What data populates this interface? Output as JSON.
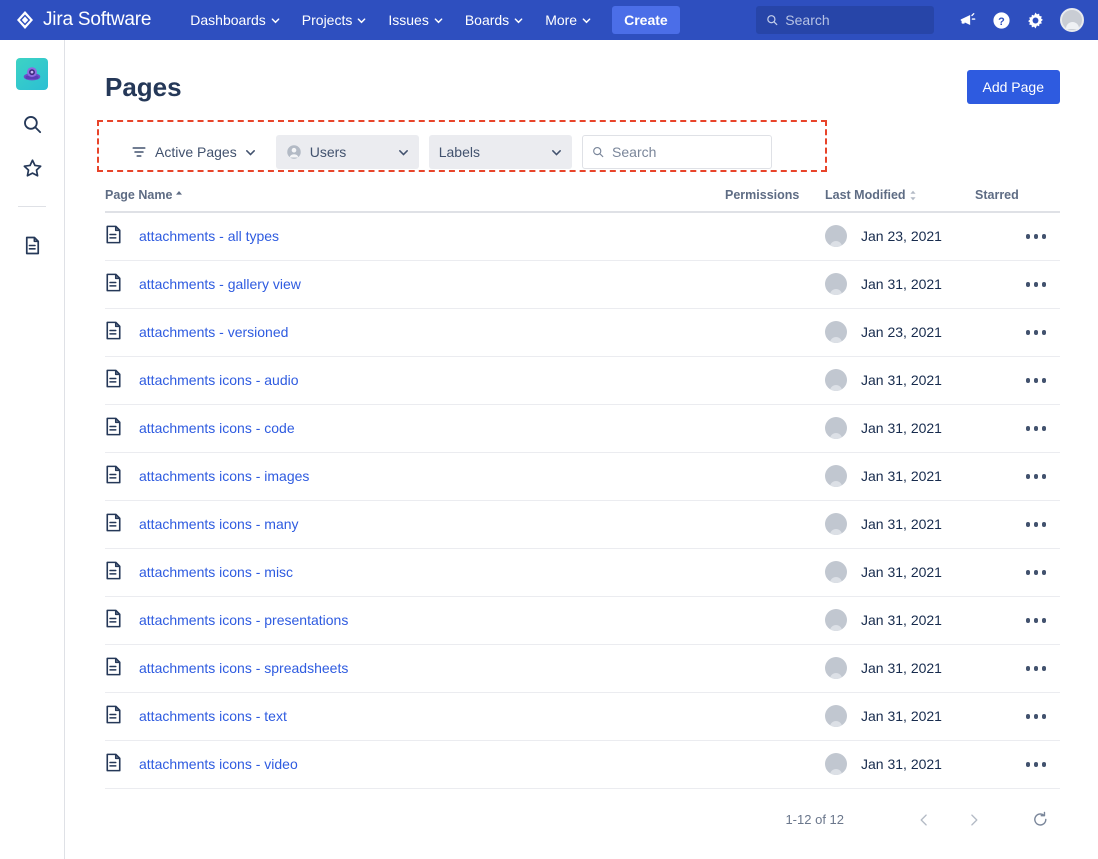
{
  "topnav": {
    "brand": "Jira Software",
    "brand_icon": "jira-diamond-logo",
    "items": [
      {
        "label": "Dashboards",
        "icon": "chevron-down-icon"
      },
      {
        "label": "Projects",
        "icon": "chevron-down-icon"
      },
      {
        "label": "Issues",
        "icon": "chevron-down-icon"
      },
      {
        "label": "Boards",
        "icon": "chevron-down-icon"
      },
      {
        "label": "More",
        "icon": "chevron-down-icon"
      }
    ],
    "create_label": "Create",
    "search_placeholder": "Search",
    "search_value": "",
    "icons": [
      "megaphone-icon",
      "help-icon",
      "gear-icon",
      "user-avatar"
    ],
    "bg_color": "#2E4FBF",
    "create_bg_color": "#4B6EE8"
  },
  "sidebar": {
    "items": [
      {
        "name": "project-avatar",
        "icon": "project-avatar-icon"
      },
      {
        "name": "search",
        "icon": "search-icon"
      },
      {
        "name": "starred",
        "icon": "star-icon"
      },
      {
        "name": "pages",
        "icon": "document-icon"
      }
    ]
  },
  "page": {
    "title": "Pages",
    "add_page_label": "Add Page"
  },
  "filters": {
    "annotation_color": "#E8442A",
    "status": {
      "label": "Active Pages",
      "icon": "filter-icon",
      "chevron": "chevron-down-icon"
    },
    "users": {
      "label": "Users",
      "icon": "person-icon",
      "chevron": "chevron-down-icon"
    },
    "labels": {
      "label": "Labels",
      "chevron": "chevron-down-icon"
    },
    "search": {
      "placeholder": "Search",
      "value": "",
      "icon": "search-icon"
    }
  },
  "table": {
    "columns": {
      "name": "Page Name",
      "permissions": "Permissions",
      "last_modified": "Last Modified",
      "starred": "Starred"
    },
    "sort": {
      "column": "Page Name",
      "direction": "asc"
    },
    "rows": [
      {
        "name": "attachments - all types",
        "icon": "document-icon",
        "permissions": "",
        "modified": "Jan 23, 2021",
        "starred": "",
        "menu": "more-actions-icon"
      },
      {
        "name": "attachments - gallery view",
        "icon": "document-icon",
        "permissions": "",
        "modified": "Jan 31, 2021",
        "starred": "",
        "menu": "more-actions-icon"
      },
      {
        "name": "attachments - versioned",
        "icon": "document-icon",
        "permissions": "",
        "modified": "Jan 23, 2021",
        "starred": "",
        "menu": "more-actions-icon"
      },
      {
        "name": "attachments icons - audio",
        "icon": "document-icon",
        "permissions": "",
        "modified": "Jan 31, 2021",
        "starred": "",
        "menu": "more-actions-icon"
      },
      {
        "name": "attachments icons - code",
        "icon": "document-icon",
        "permissions": "",
        "modified": "Jan 31, 2021",
        "starred": "",
        "menu": "more-actions-icon"
      },
      {
        "name": "attachments icons - images",
        "icon": "document-icon",
        "permissions": "",
        "modified": "Jan 31, 2021",
        "starred": "",
        "menu": "more-actions-icon"
      },
      {
        "name": "attachments icons - many",
        "icon": "document-icon",
        "permissions": "",
        "modified": "Jan 31, 2021",
        "starred": "",
        "menu": "more-actions-icon"
      },
      {
        "name": "attachments icons - misc",
        "icon": "document-icon",
        "permissions": "",
        "modified": "Jan 31, 2021",
        "starred": "",
        "menu": "more-actions-icon"
      },
      {
        "name": "attachments icons - presentations",
        "icon": "document-icon",
        "permissions": "",
        "modified": "Jan 31, 2021",
        "starred": "",
        "menu": "more-actions-icon"
      },
      {
        "name": "attachments icons - spreadsheets",
        "icon": "document-icon",
        "permissions": "",
        "modified": "Jan 31, 2021",
        "starred": "",
        "menu": "more-actions-icon"
      },
      {
        "name": "attachments icons - text",
        "icon": "document-icon",
        "permissions": "",
        "modified": "Jan 31, 2021",
        "starred": "",
        "menu": "more-actions-icon"
      },
      {
        "name": "attachments icons - video",
        "icon": "document-icon",
        "permissions": "",
        "modified": "Jan 31, 2021",
        "starred": "",
        "menu": "more-actions-icon"
      }
    ]
  },
  "pagination": {
    "count_label": "1-12 of 12",
    "prev_icon": "chevron-left-icon",
    "next_icon": "chevron-right-icon",
    "refresh_icon": "refresh-icon"
  }
}
